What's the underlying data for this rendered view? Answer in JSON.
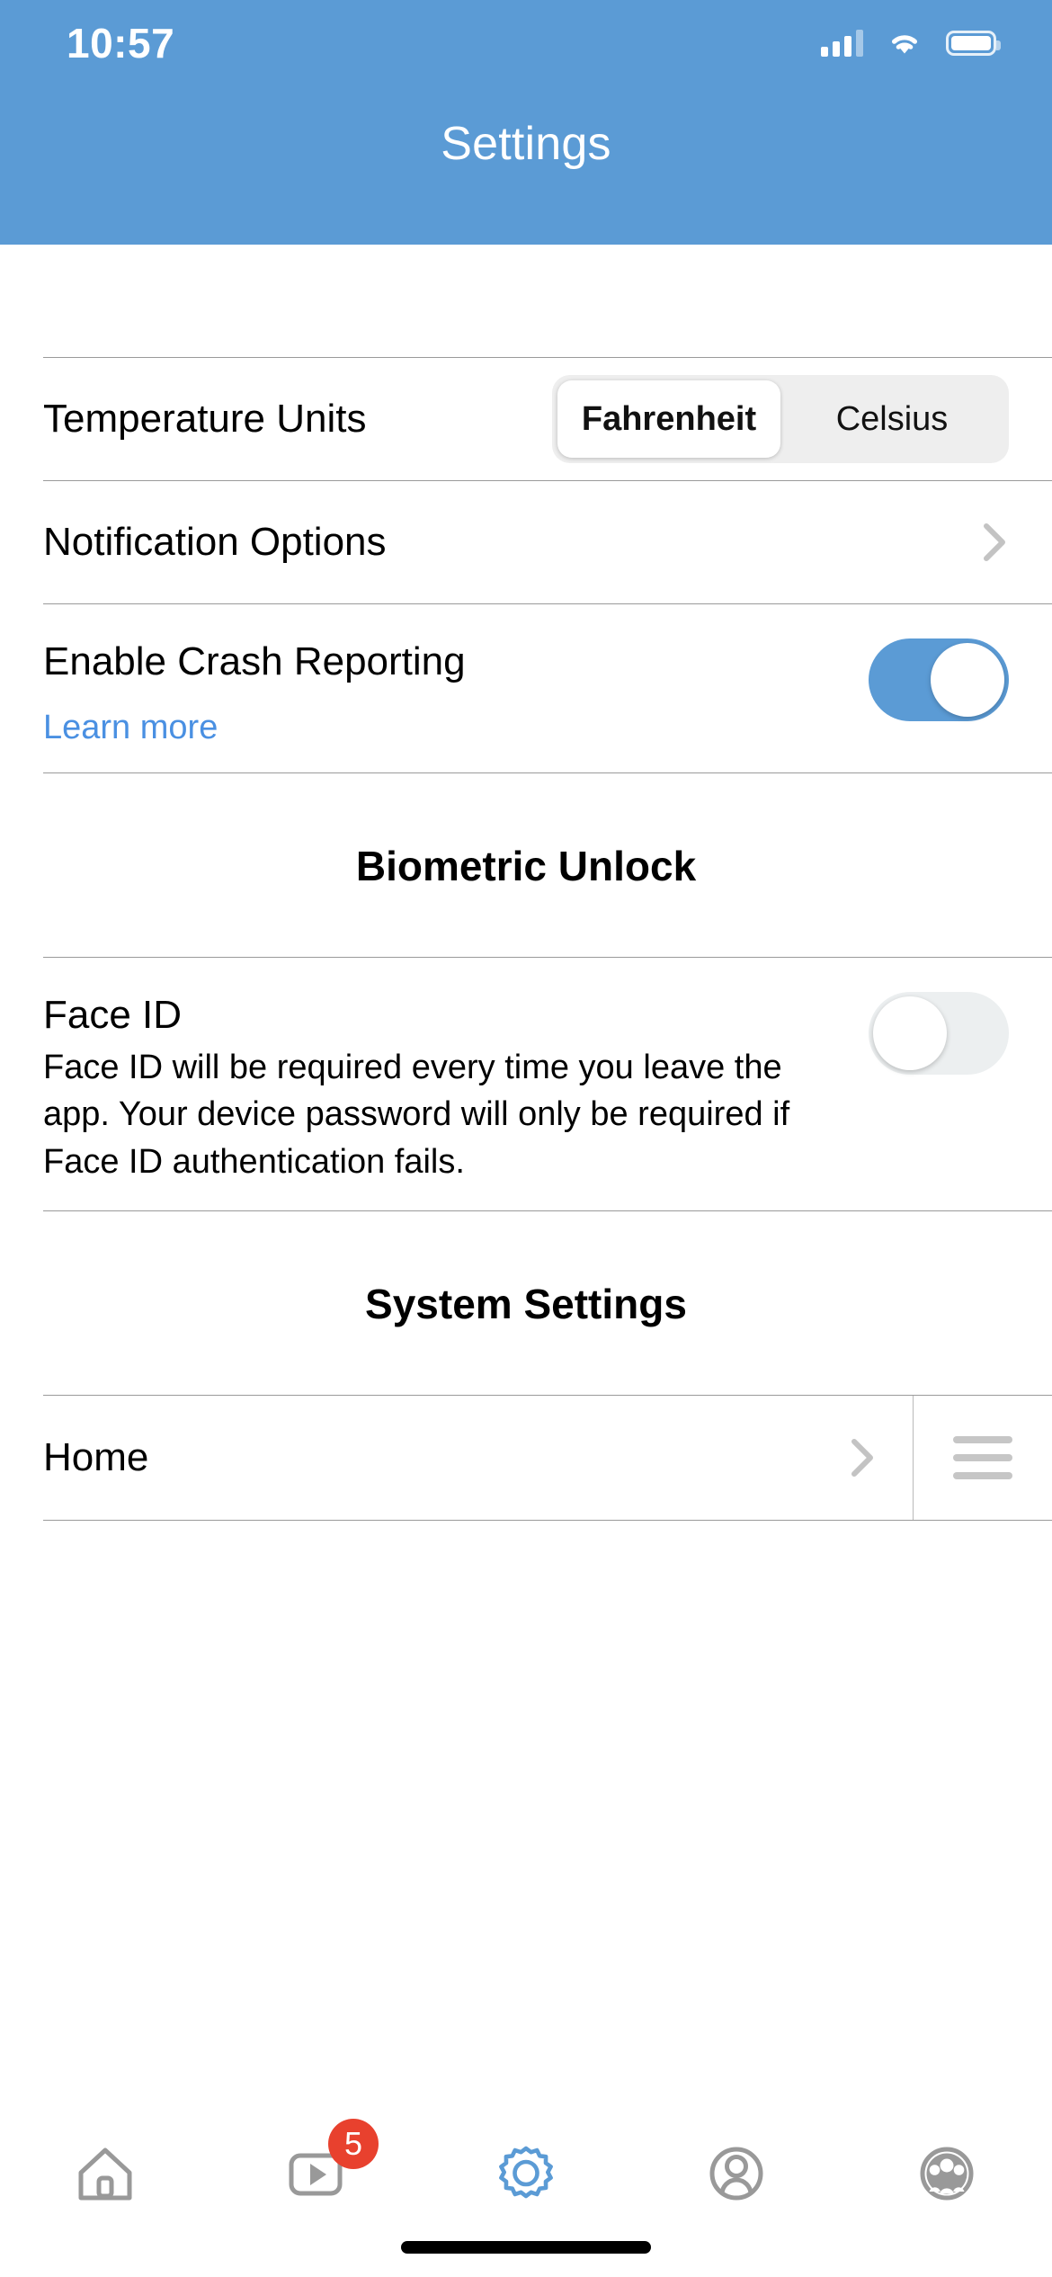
{
  "status_bar": {
    "time": "10:57",
    "signal_icon": "cellular-signal-icon",
    "wifi_icon": "wifi-icon",
    "battery_icon": "battery-icon"
  },
  "header": {
    "title": "Settings",
    "background_color": "#5b9bd5"
  },
  "settings": {
    "temperature_units": {
      "label": "Temperature Units",
      "options": [
        "Fahrenheit",
        "Celsius"
      ],
      "selected": "Fahrenheit"
    },
    "notification_options": {
      "label": "Notification Options",
      "accessory_icon": "chevron-right-icon"
    },
    "crash_reporting": {
      "label": "Enable Crash Reporting",
      "link_label": "Learn more",
      "link_color": "#4a90e2",
      "toggle_state": "on",
      "toggle_on_color": "#5b9bd5"
    }
  },
  "biometric_section": {
    "title": "Biometric Unlock",
    "face_id": {
      "label": "Face ID",
      "description": "Face ID will be required every time you leave the app. Your device password will only be required if Face ID authentication fails.",
      "toggle_state": "off",
      "toggle_off_color": "#eceff0"
    }
  },
  "system_section": {
    "title": "System Settings",
    "rows": [
      {
        "label": "Home",
        "accessory_icon": "chevron-right-icon",
        "reorder_icon": "reorder-handle-icon"
      }
    ]
  },
  "tab_bar": {
    "items": [
      {
        "name": "home",
        "icon": "home-icon",
        "active": false,
        "badge": null
      },
      {
        "name": "videos",
        "icon": "video-play-icon",
        "active": false,
        "badge": "5"
      },
      {
        "name": "settings",
        "icon": "gear-icon",
        "active": true,
        "badge": null
      },
      {
        "name": "profile",
        "icon": "person-circle-icon",
        "active": false,
        "badge": null
      },
      {
        "name": "groups",
        "icon": "people-group-circle-icon",
        "active": false,
        "badge": null
      }
    ],
    "active_color": "#5b9bd5",
    "inactive_color": "#999999",
    "badge_color": "#e8412e"
  },
  "home_indicator": {
    "icon": "home-indicator-bar"
  }
}
